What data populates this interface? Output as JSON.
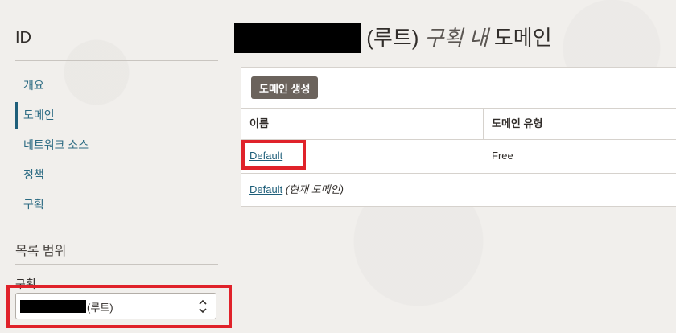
{
  "sidebar": {
    "title": "ID",
    "items": [
      {
        "label": "개요",
        "active": false
      },
      {
        "label": "도메인",
        "active": true
      },
      {
        "label": "네트워크 소스",
        "active": false
      },
      {
        "label": "정책",
        "active": false
      },
      {
        "label": "구획",
        "active": false
      }
    ],
    "scope_title": "목록 범위",
    "compartment_label": "구획",
    "compartment_value": "(루트)"
  },
  "main": {
    "title_suffix": "(루트)",
    "title_italic": "구획 내",
    "title_end": "도메인",
    "create_button": "도메인 생성",
    "table": {
      "headers": [
        "이름",
        "도메인 유형"
      ],
      "rows": [
        {
          "name": "Default",
          "type": "Free"
        }
      ]
    },
    "footer": {
      "link": "Default",
      "note": "(현재 도메인)"
    }
  },
  "colors": {
    "accent": "#1f5f7a",
    "highlight": "#e0222a",
    "button": "#6b635c"
  }
}
